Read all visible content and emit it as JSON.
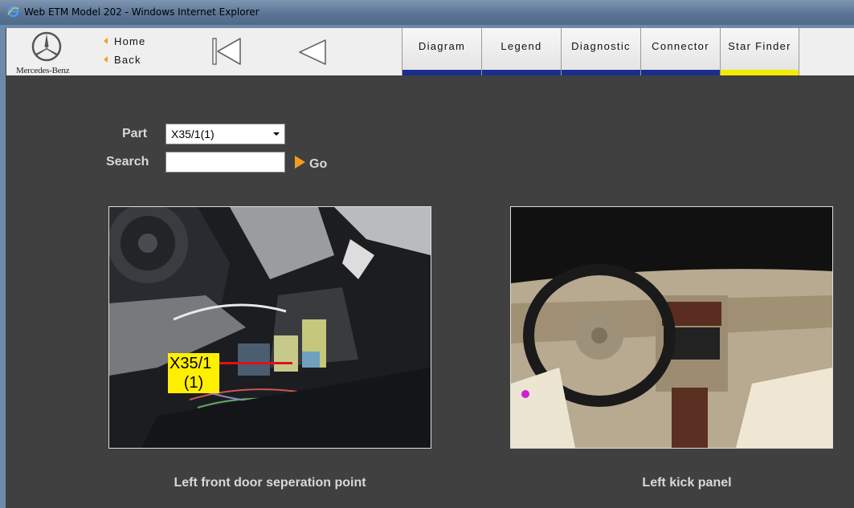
{
  "window": {
    "title": "Web ETM Model 202 - Windows Internet Explorer"
  },
  "header": {
    "brand": "Mercedes-Benz",
    "nav": {
      "home_label": "Home",
      "back_label": "Back"
    },
    "tabs": [
      {
        "label": "Diagram",
        "bar_color": "#1a2e8c"
      },
      {
        "label": "Legend",
        "bar_color": "#1a2e8c"
      },
      {
        "label": "Diagnostic",
        "bar_color": "#1a2e8c"
      },
      {
        "label": "Connector",
        "bar_color": "#1a2e8c"
      },
      {
        "label": "Star Finder",
        "bar_color": "#f2ec00"
      }
    ]
  },
  "form": {
    "part_label": "Part",
    "part_value": "X35/1(1)",
    "search_label": "Search",
    "search_value": "",
    "go_label": "Go"
  },
  "photos": [
    {
      "caption": "Left front door seperation point",
      "callout_line1": "X35/1",
      "callout_line2": "(1)"
    },
    {
      "caption": "Left kick panel"
    }
  ],
  "colors": {
    "background": "#404040",
    "accent": "#f0a020",
    "callout": "#ffef00",
    "callout_line": "#e0101a"
  }
}
